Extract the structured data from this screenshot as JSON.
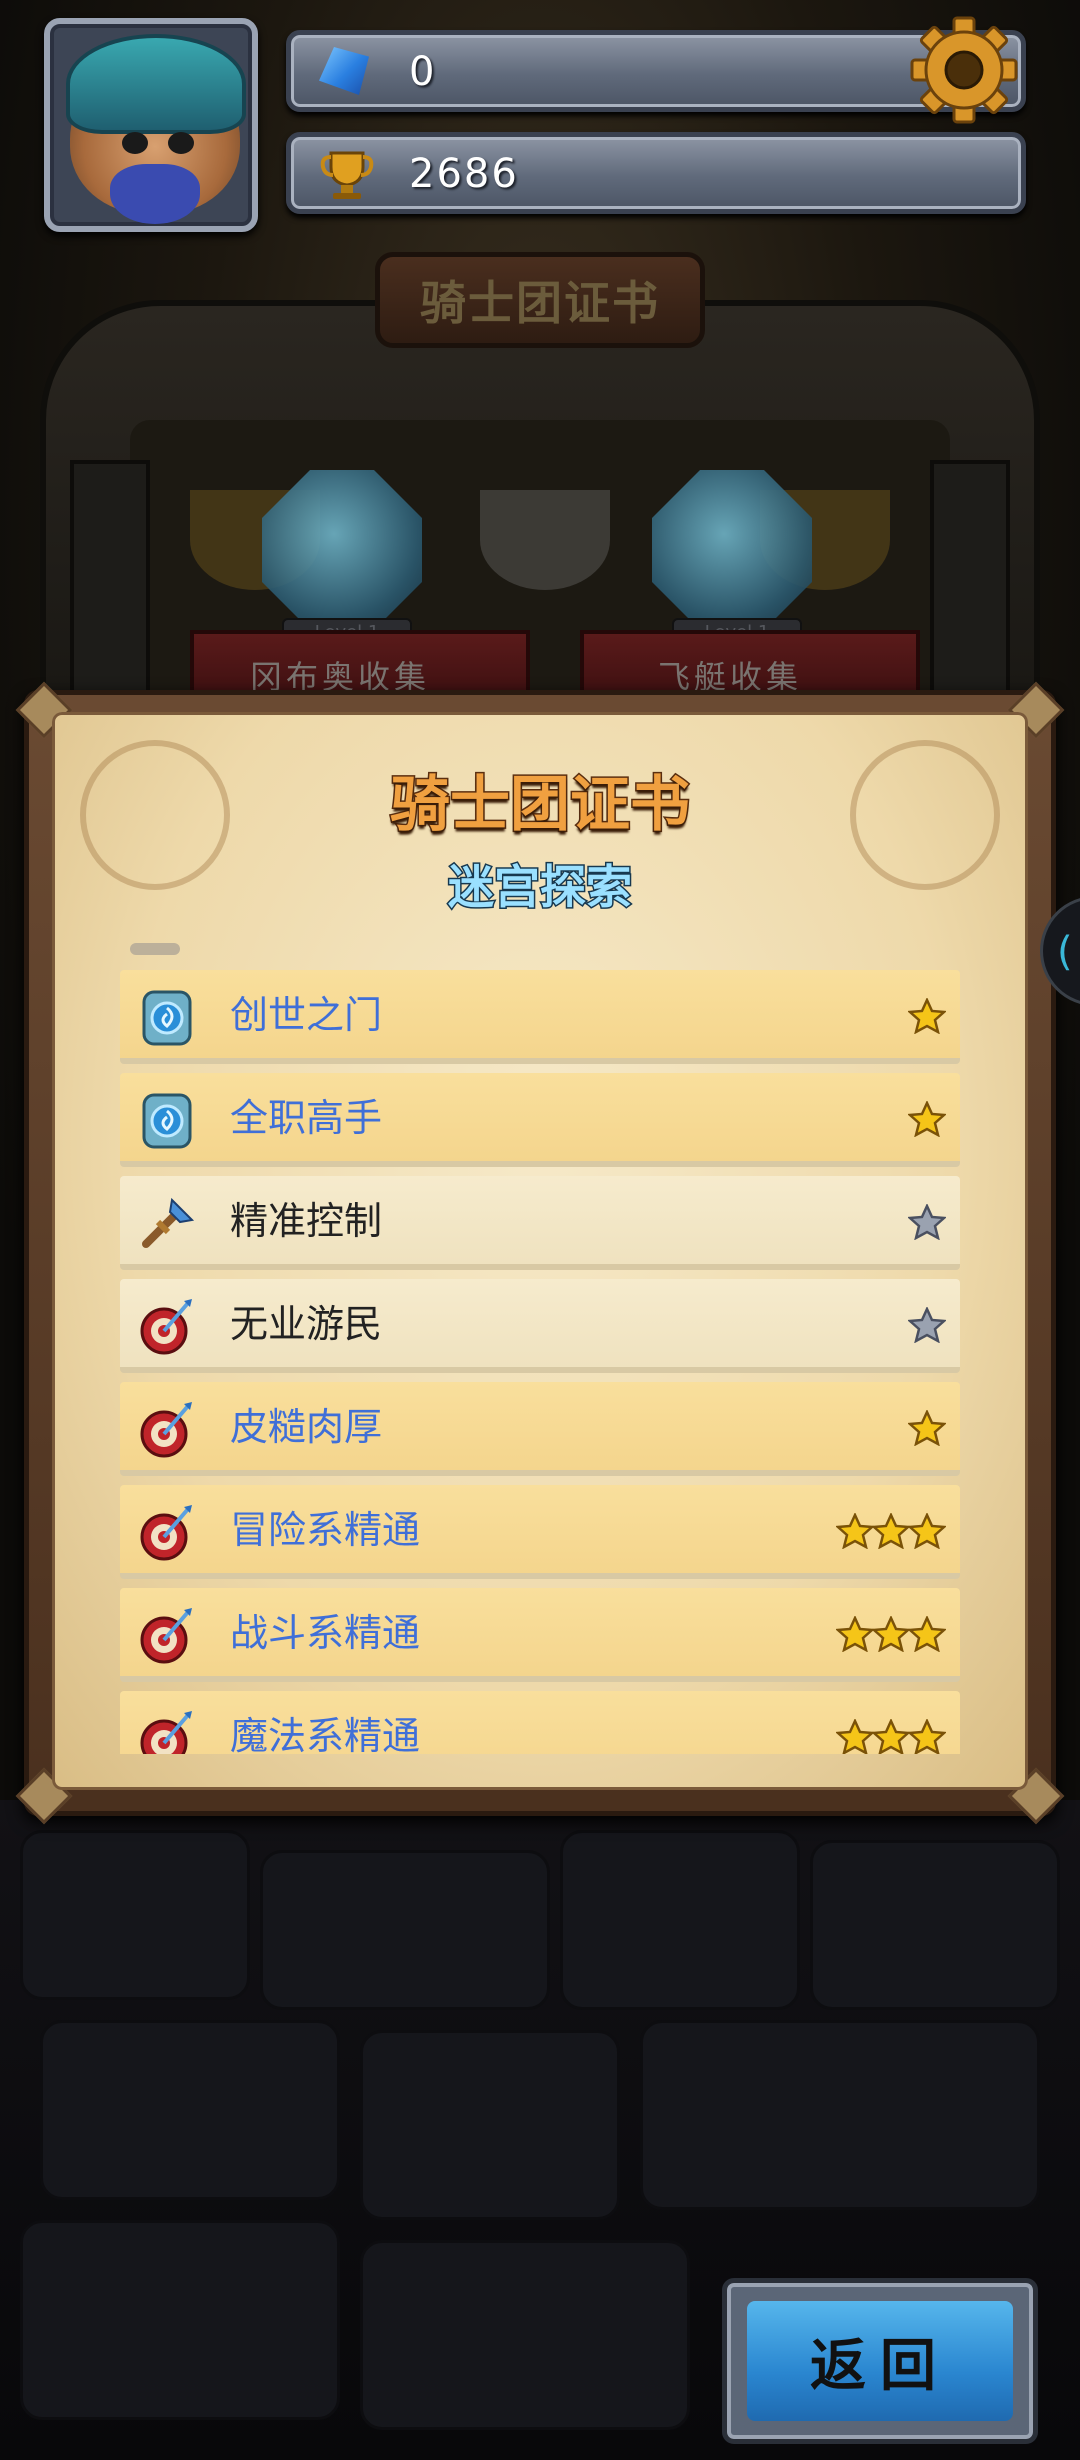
{
  "header": {
    "gems": "0",
    "trophies": "2686"
  },
  "backdrop": {
    "title": "骑士团证书",
    "collections": [
      {
        "label": "冈布奥收集",
        "level": "Level 1"
      },
      {
        "label": "飞艇收集",
        "level": "Level 1"
      }
    ]
  },
  "panel": {
    "title": "骑士团证书",
    "subtitle": "迷宫探索",
    "items": [
      {
        "label": "创世之门",
        "icon": "portal-icon",
        "stars": 1,
        "star_color": "gold",
        "highlight": true
      },
      {
        "label": "全职高手",
        "icon": "portal-icon",
        "stars": 1,
        "star_color": "gold",
        "highlight": true
      },
      {
        "label": "精准控制",
        "icon": "sword-icon",
        "stars": 1,
        "star_color": "silver",
        "highlight": false
      },
      {
        "label": "无业游民",
        "icon": "target-icon",
        "stars": 1,
        "star_color": "silver",
        "highlight": false
      },
      {
        "label": "皮糙肉厚",
        "icon": "target-icon",
        "stars": 1,
        "star_color": "gold",
        "highlight": true
      },
      {
        "label": "冒险系精通",
        "icon": "target-icon",
        "stars": 3,
        "star_color": "gold",
        "highlight": true
      },
      {
        "label": "战斗系精通",
        "icon": "target-icon",
        "stars": 3,
        "star_color": "gold",
        "highlight": true
      },
      {
        "label": "魔法系精通",
        "icon": "target-icon",
        "stars": 3,
        "star_color": "gold",
        "highlight": true
      }
    ]
  },
  "buttons": {
    "return_label": "返回"
  },
  "colors": {
    "gold_star": "#f5c518",
    "silver_star": "#9aa2b0",
    "blue_label": "#3f6fd8",
    "title_orange": "#f0a040",
    "subtitle_cyan": "#9ae0ff",
    "return_button": "#2a86d0"
  }
}
